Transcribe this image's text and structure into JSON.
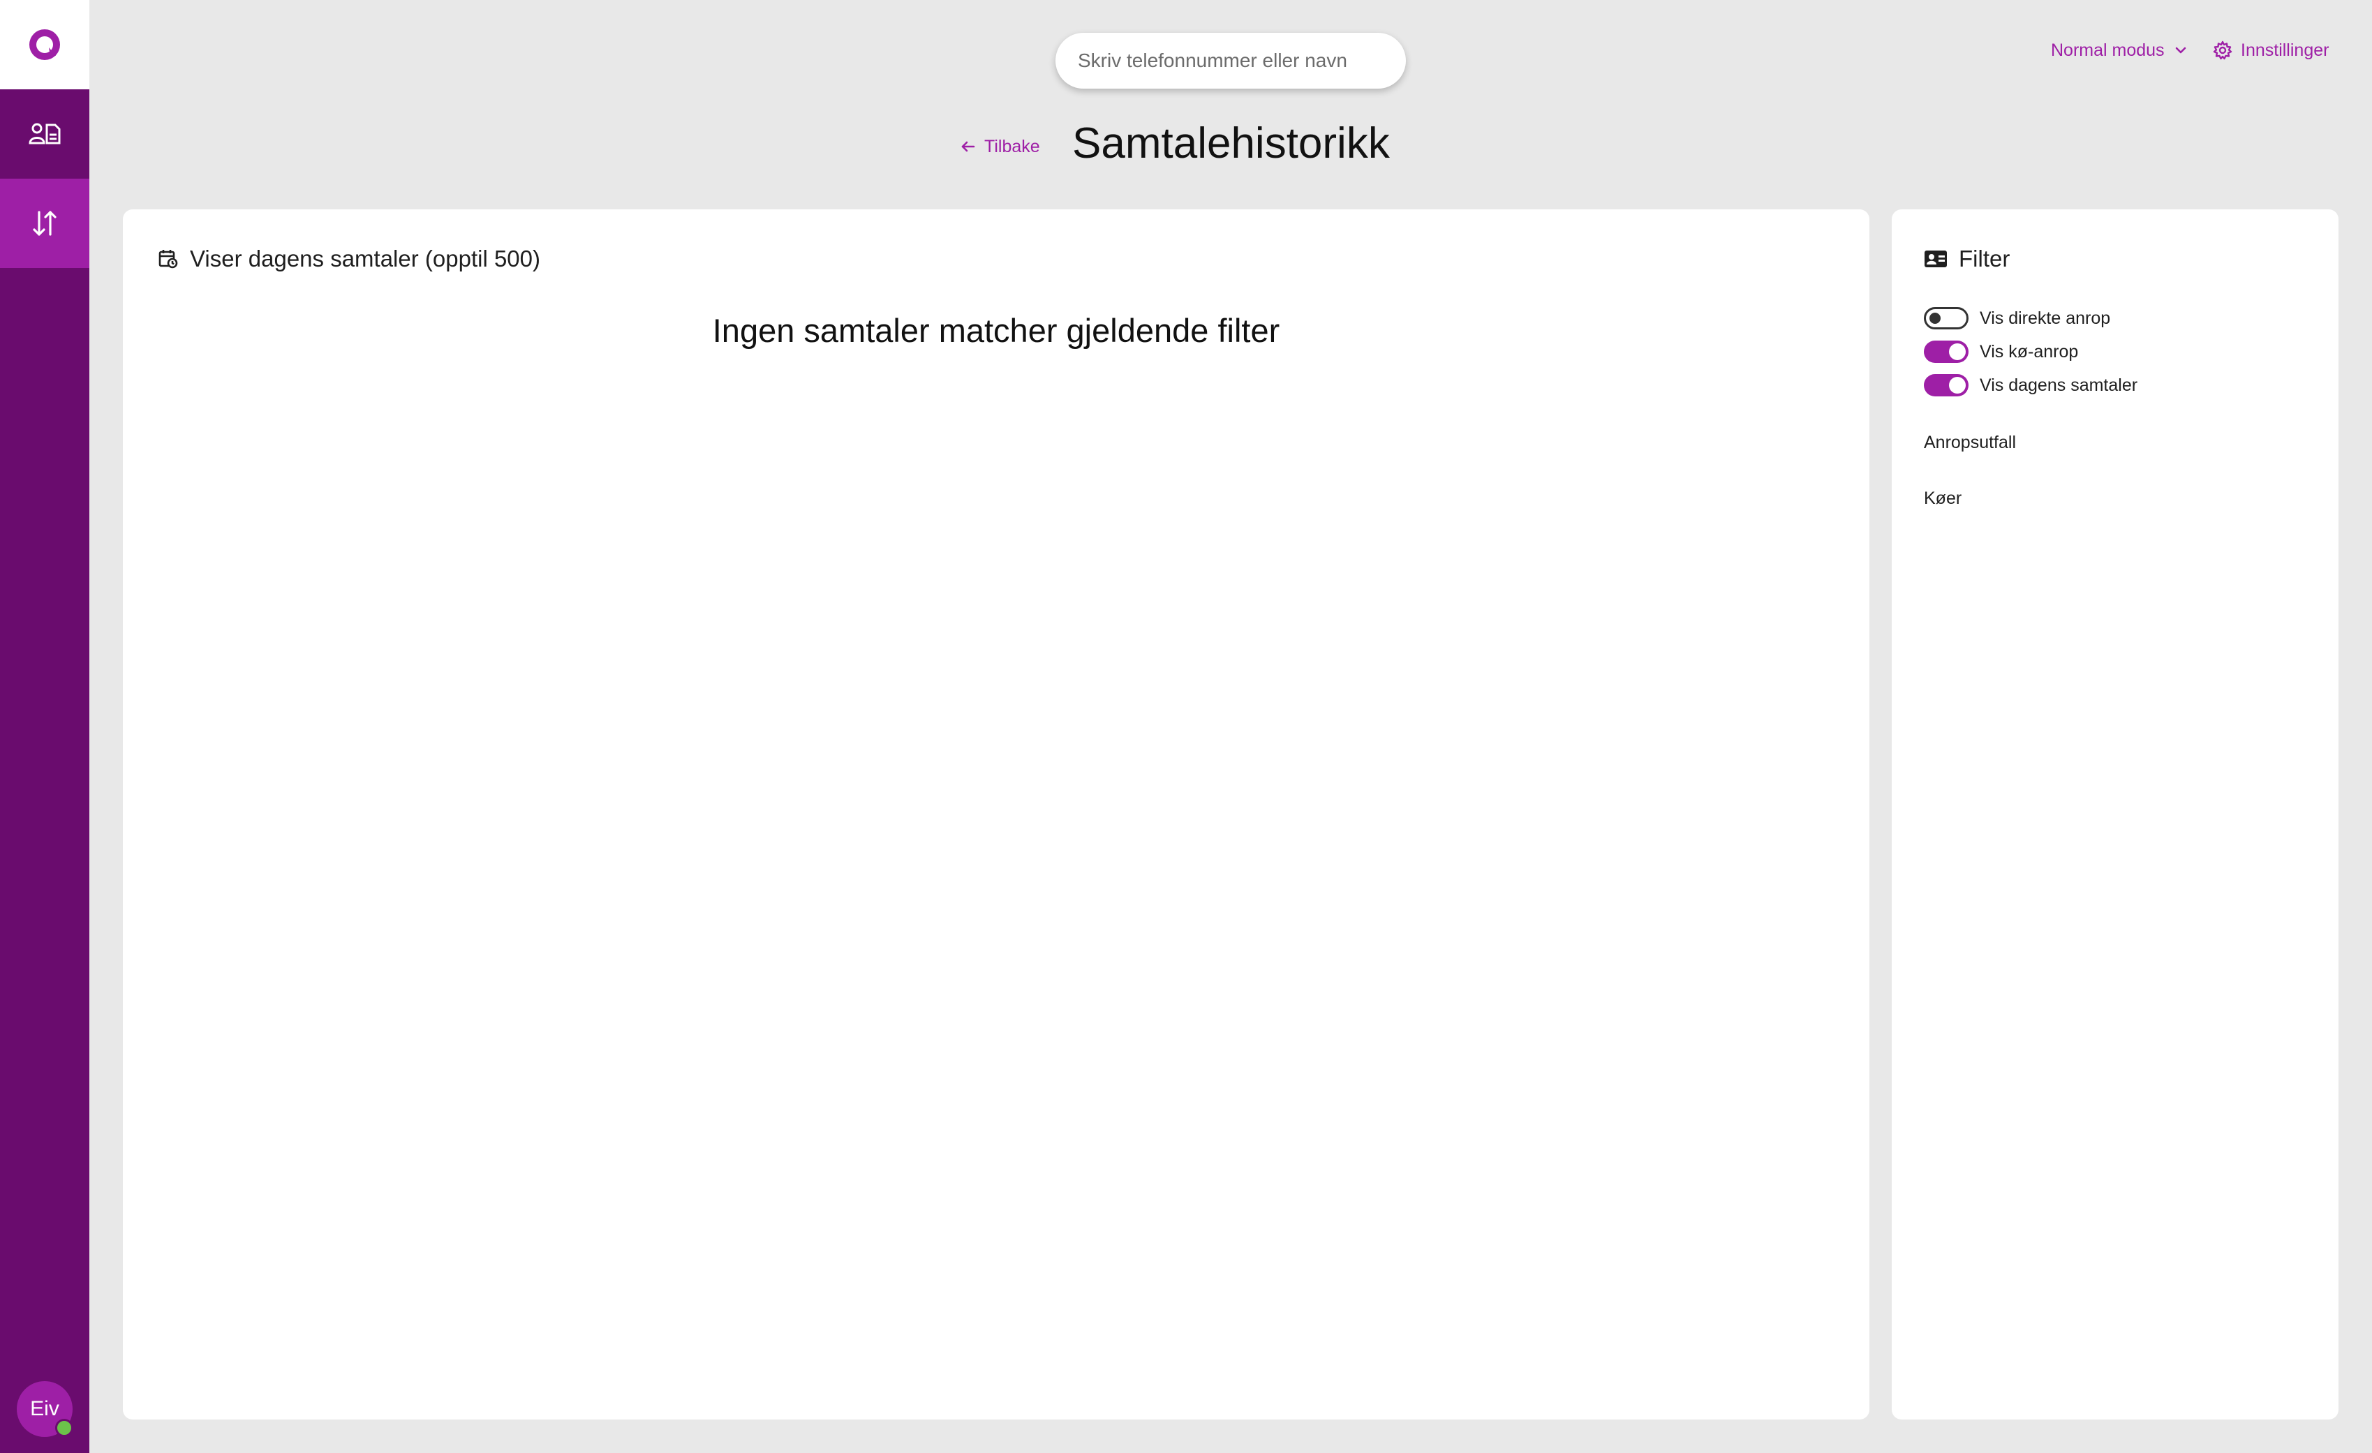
{
  "sidebar": {
    "logo_icon": "app-logo-icon",
    "items": [
      {
        "name": "contacts",
        "icon": "contacts-icon",
        "active": false
      },
      {
        "name": "call-history",
        "icon": "call-history-icon",
        "active": true
      }
    ],
    "avatar_initials": "Eiv",
    "status_color": "#6cc24a"
  },
  "header": {
    "search_placeholder": "Skriv telefonnummer eller navn",
    "mode_label": "Normal modus",
    "settings_label": "Innstillinger",
    "back_label": "Tilbake",
    "page_title": "Samtalehistorikk"
  },
  "main": {
    "title": "Viser dagens samtaler (opptil 500)",
    "empty_message": "Ingen samtaler matcher gjeldende filter"
  },
  "filter": {
    "title": "Filter",
    "toggles": [
      {
        "label": "Vis direkte anrop",
        "checked": false
      },
      {
        "label": "Vis kø-anrop",
        "checked": true
      },
      {
        "label": "Vis dagens samtaler",
        "checked": true
      }
    ],
    "sections": [
      "Anropsutfall",
      "Køer"
    ]
  },
  "colors": {
    "brand_dark": "#6a0c6e",
    "brand_accent": "#9e1fa6",
    "background": "#e8e8e8"
  }
}
